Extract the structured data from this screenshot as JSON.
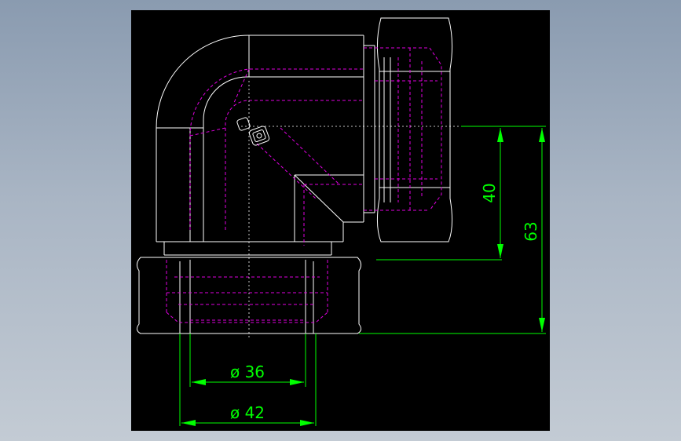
{
  "dimensions": {
    "bore_36": "ø 36",
    "bore_42": "ø 42",
    "height_40": "40",
    "height_63": "63"
  },
  "colors": {
    "background": "#000000",
    "outline": "#ffffff",
    "hidden": "#e000e0",
    "dimension": "#00ff00",
    "frame": "#a0aebf"
  }
}
